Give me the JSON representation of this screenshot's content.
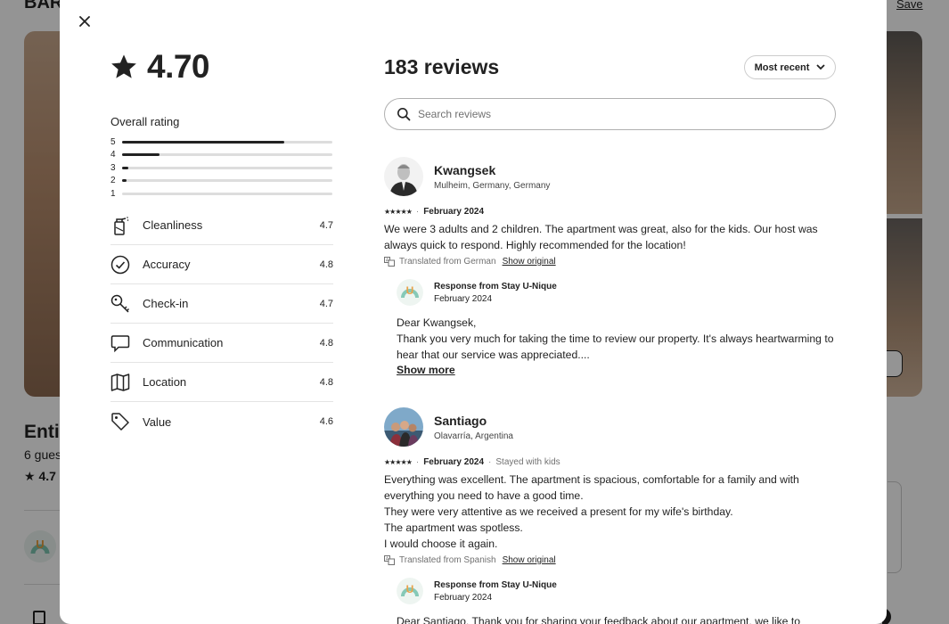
{
  "background": {
    "title": "BAR",
    "save_label": "Save",
    "listing_title": "Entir",
    "guests_text": "6 gues",
    "rating_text": "4.7"
  },
  "modal": {
    "overall_score": "4.70",
    "overall_label": "Overall rating",
    "histogram": [
      {
        "stars": "5",
        "fraction": 0.77
      },
      {
        "stars": "4",
        "fraction": 0.18
      },
      {
        "stars": "3",
        "fraction": 0.03
      },
      {
        "stars": "2",
        "fraction": 0.02
      },
      {
        "stars": "1",
        "fraction": 0.0
      }
    ],
    "categories": [
      {
        "label": "Cleanliness",
        "value": "4.7",
        "icon": "spray-bottle-icon"
      },
      {
        "label": "Accuracy",
        "value": "4.8",
        "icon": "check-circle-icon"
      },
      {
        "label": "Check-in",
        "value": "4.7",
        "icon": "key-icon"
      },
      {
        "label": "Communication",
        "value": "4.8",
        "icon": "chat-bubble-icon"
      },
      {
        "label": "Location",
        "value": "4.8",
        "icon": "map-icon"
      },
      {
        "label": "Value",
        "value": "4.6",
        "icon": "tag-icon"
      }
    ],
    "reviews_title": "183 reviews",
    "sort_label": "Most recent",
    "search_placeholder": "Search reviews",
    "reviews": [
      {
        "name": "Kwangsek",
        "location": "Mulheim, Germany, Germany",
        "stars": 5,
        "date": "February 2024",
        "extra": "",
        "text": "We were 3 adults and 2 children. The apartment was great, also for the kids. Our host was always quick to respond. Highly recommended for the location!",
        "translated": "Translated from German",
        "show_original": "Show original",
        "response": {
          "from": "Response from Stay U-Nique",
          "date": "February 2024",
          "text_line1": "Dear Kwangsek,",
          "text_line2": "Thank you very much for taking the time to review our property. It's always heartwarming to hear that our service was appreciated....",
          "show_more": "Show more"
        }
      },
      {
        "name": "Santiago",
        "location": "Olavarría, Argentina",
        "stars": 5,
        "date": "February 2024",
        "extra": "Stayed with kids",
        "text": "Everything was excellent. The apartment is spacious, comfortable for a family and with everything you need to have a good time.",
        "text2": "They were very attentive as we received a present for my wife's birthday.",
        "text3": "The apartment was spotless.",
        "text4": "I would choose it again.",
        "translated": "Translated from Spanish",
        "show_original": "Show original",
        "response": {
          "from": "Response from Stay U-Nique",
          "date": "February 2024",
          "text_line1": "Dear Santiago, Thank you for sharing your feedback about our apartment, we like to"
        }
      }
    ]
  }
}
